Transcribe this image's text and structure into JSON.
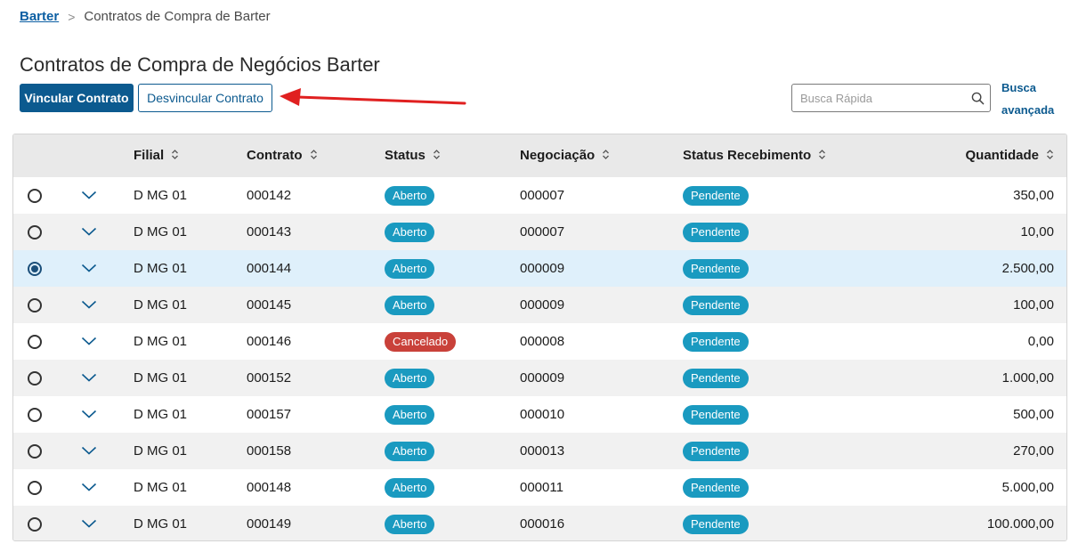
{
  "breadcrumb": {
    "root": "Barter",
    "separator": ">",
    "current": "Contratos de Compra de Barter"
  },
  "page_title": "Contratos de Compra de Negócios Barter",
  "toolbar": {
    "link_label": "Vincular Contrato",
    "unlink_label": "Desvincular Contrato"
  },
  "search": {
    "placeholder": "Busca Rápida",
    "advanced_line1": "Busca",
    "advanced_line2": "avançada"
  },
  "colors": {
    "primary": "#0c5a8f",
    "badge_blue": "#1a9ac0",
    "badge_red": "#c9413a",
    "arrow_red": "#e02020",
    "selected_row": "#dff0fb"
  },
  "table": {
    "columns": [
      "Filial",
      "Contrato",
      "Status",
      "Negociação",
      "Status Recebimento",
      "Quantidade"
    ],
    "rows": [
      {
        "filial": "D MG 01",
        "contrato": "000142",
        "status": "Aberto",
        "status_color": "blue",
        "negociacao": "000007",
        "recebimento": "Pendente",
        "quantidade": "350,00",
        "selected": false
      },
      {
        "filial": "D MG 01",
        "contrato": "000143",
        "status": "Aberto",
        "status_color": "blue",
        "negociacao": "000007",
        "recebimento": "Pendente",
        "quantidade": "10,00",
        "selected": false
      },
      {
        "filial": "D MG 01",
        "contrato": "000144",
        "status": "Aberto",
        "status_color": "blue",
        "negociacao": "000009",
        "recebimento": "Pendente",
        "quantidade": "2.500,00",
        "selected": true
      },
      {
        "filial": "D MG 01",
        "contrato": "000145",
        "status": "Aberto",
        "status_color": "blue",
        "negociacao": "000009",
        "recebimento": "Pendente",
        "quantidade": "100,00",
        "selected": false
      },
      {
        "filial": "D MG 01",
        "contrato": "000146",
        "status": "Cancelado",
        "status_color": "red",
        "negociacao": "000008",
        "recebimento": "Pendente",
        "quantidade": "0,00",
        "selected": false
      },
      {
        "filial": "D MG 01",
        "contrato": "000152",
        "status": "Aberto",
        "status_color": "blue",
        "negociacao": "000009",
        "recebimento": "Pendente",
        "quantidade": "1.000,00",
        "selected": false
      },
      {
        "filial": "D MG 01",
        "contrato": "000157",
        "status": "Aberto",
        "status_color": "blue",
        "negociacao": "000010",
        "recebimento": "Pendente",
        "quantidade": "500,00",
        "selected": false
      },
      {
        "filial": "D MG 01",
        "contrato": "000158",
        "status": "Aberto",
        "status_color": "blue",
        "negociacao": "000013",
        "recebimento": "Pendente",
        "quantidade": "270,00",
        "selected": false
      },
      {
        "filial": "D MG 01",
        "contrato": "000148",
        "status": "Aberto",
        "status_color": "blue",
        "negociacao": "000011",
        "recebimento": "Pendente",
        "quantidade": "5.000,00",
        "selected": false
      },
      {
        "filial": "D MG 01",
        "contrato": "000149",
        "status": "Aberto",
        "status_color": "blue",
        "negociacao": "000016",
        "recebimento": "Pendente",
        "quantidade": "100.000,00",
        "selected": false
      }
    ]
  }
}
